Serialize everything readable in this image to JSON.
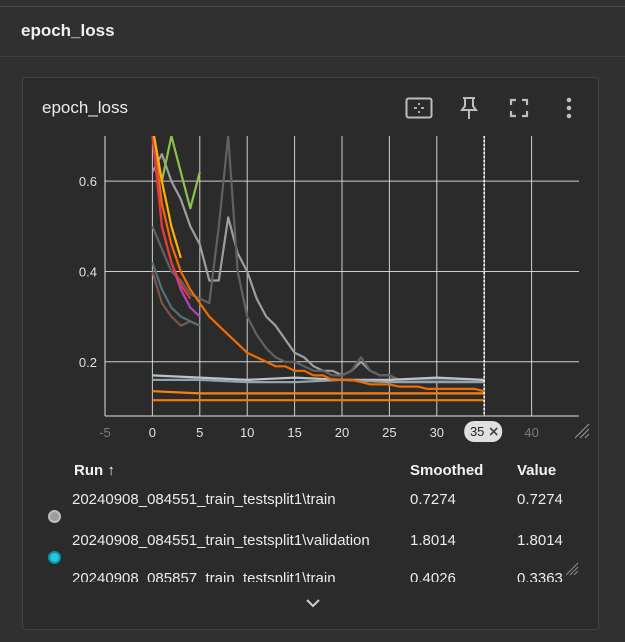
{
  "section": {
    "title": "epoch_loss"
  },
  "card": {
    "title": "epoch_loss",
    "toolbar": [
      {
        "name": "fit-domain-icon",
        "label": "Fit domain to data"
      },
      {
        "name": "pin-icon",
        "label": "Pin card"
      },
      {
        "name": "fullscreen-icon",
        "label": "Toggle fullscreen"
      },
      {
        "name": "more-vert-icon",
        "label": "More options"
      }
    ]
  },
  "chart_data": {
    "type": "line",
    "title": "",
    "xlabel": "",
    "ylabel": "",
    "xlim": [
      -5,
      45
    ],
    "ylim": [
      0.08,
      0.7
    ],
    "xticks": [
      "-5",
      "0",
      "5",
      "10",
      "15",
      "20",
      "25",
      "30",
      "35",
      "40"
    ],
    "yticks": [
      "0.2",
      "0.4",
      "0.6"
    ],
    "grid": true,
    "hover_step": "35",
    "series": [
      {
        "color": "#9e9e9e",
        "x": [
          0,
          1,
          2,
          3,
          4,
          5,
          6,
          7,
          8,
          9,
          10,
          11,
          12,
          13,
          14,
          15,
          16,
          17,
          18,
          19,
          20,
          21,
          22,
          23,
          24,
          25,
          26,
          27,
          28,
          29,
          30,
          31,
          32,
          33,
          34,
          35
        ],
        "y": [
          0.62,
          0.66,
          0.6,
          0.56,
          0.5,
          0.46,
          0.38,
          0.38,
          0.52,
          0.44,
          0.4,
          0.34,
          0.3,
          0.28,
          0.25,
          0.22,
          0.21,
          0.19,
          0.18,
          0.18,
          0.17,
          0.18,
          0.2,
          0.18,
          0.17,
          0.17,
          0.16,
          0.16,
          0.16,
          0.16,
          0.16,
          0.16,
          0.16,
          0.16,
          0.16,
          0.155
        ]
      },
      {
        "color": "#616161",
        "x": [
          0,
          1,
          2,
          3,
          4,
          5,
          6,
          7,
          8,
          9,
          10,
          11,
          12,
          13,
          14,
          15,
          16,
          17,
          18,
          19,
          20,
          21,
          22,
          23,
          24,
          25,
          26,
          27,
          28,
          29,
          30,
          31,
          32,
          33,
          34,
          35
        ],
        "y": [
          0.5,
          0.45,
          0.4,
          0.38,
          0.35,
          0.34,
          0.33,
          0.5,
          0.7,
          0.4,
          0.3,
          0.26,
          0.23,
          0.21,
          0.2,
          0.2,
          0.19,
          0.18,
          0.18,
          0.17,
          0.17,
          0.18,
          0.21,
          0.18,
          0.17,
          0.17,
          0.16,
          0.16,
          0.16,
          0.16,
          0.16,
          0.16,
          0.16,
          0.16,
          0.16,
          0.16
        ]
      },
      {
        "color": "#bdc3c7",
        "x": [
          0,
          5,
          10,
          15,
          20,
          25,
          30,
          35
        ],
        "y": [
          0.17,
          0.165,
          0.16,
          0.165,
          0.16,
          0.16,
          0.165,
          0.16
        ]
      },
      {
        "color": "#90a4ae",
        "x": [
          0,
          5,
          10,
          15,
          20,
          25,
          30,
          35
        ],
        "y": [
          0.16,
          0.16,
          0.155,
          0.155,
          0.16,
          0.155,
          0.155,
          0.155
        ]
      },
      {
        "color": "#ef6c00",
        "x": [
          0,
          1,
          2,
          3,
          4,
          5,
          6,
          7,
          8,
          9,
          10,
          11,
          12,
          13,
          14,
          15,
          16,
          17,
          18,
          19,
          20,
          21,
          22,
          23,
          24,
          25,
          26,
          27,
          28,
          29,
          30,
          31,
          32,
          33,
          34,
          35
        ],
        "y": [
          0.72,
          0.55,
          0.46,
          0.4,
          0.36,
          0.33,
          0.3,
          0.28,
          0.26,
          0.24,
          0.22,
          0.21,
          0.2,
          0.19,
          0.19,
          0.18,
          0.18,
          0.17,
          0.17,
          0.16,
          0.16,
          0.16,
          0.155,
          0.15,
          0.15,
          0.15,
          0.145,
          0.145,
          0.145,
          0.14,
          0.14,
          0.14,
          0.14,
          0.14,
          0.14,
          0.135
        ]
      },
      {
        "color": "#ff7f0e",
        "x": [
          0,
          5,
          10,
          15,
          20,
          25,
          30,
          35
        ],
        "y": [
          0.135,
          0.13,
          0.13,
          0.13,
          0.13,
          0.13,
          0.13,
          0.13
        ]
      },
      {
        "color": "#f57c00",
        "x": [
          0,
          5,
          10,
          15,
          20,
          25,
          30,
          35
        ],
        "y": [
          0.115,
          0.115,
          0.115,
          0.115,
          0.115,
          0.115,
          0.115,
          0.115
        ]
      },
      {
        "color": "#8bc34a",
        "x": [
          0,
          1,
          2,
          3,
          4,
          5
        ],
        "y": [
          0.72,
          0.6,
          0.7,
          0.62,
          0.54,
          0.62
        ]
      },
      {
        "color": "#ab47bc",
        "x": [
          0,
          1,
          2,
          3,
          4,
          5
        ],
        "y": [
          0.72,
          0.5,
          0.42,
          0.36,
          0.32,
          0.3
        ]
      },
      {
        "color": "#e53935",
        "x": [
          0,
          1,
          2,
          3,
          4
        ],
        "y": [
          0.7,
          0.5,
          0.42,
          0.37,
          0.34
        ]
      },
      {
        "color": "#ffb300",
        "x": [
          0,
          1,
          2,
          3
        ],
        "y": [
          0.72,
          0.6,
          0.5,
          0.43
        ]
      },
      {
        "color": "#795548",
        "x": [
          0,
          1,
          2,
          3,
          4,
          5
        ],
        "y": [
          0.4,
          0.33,
          0.3,
          0.28,
          0.29,
          0.28
        ]
      },
      {
        "color": "#546e7a",
        "x": [
          0,
          1,
          2,
          3,
          4,
          5
        ],
        "y": [
          0.42,
          0.36,
          0.32,
          0.3,
          0.29,
          0.28
        ]
      }
    ]
  },
  "table": {
    "headers": {
      "run": "Run ↑",
      "smoothed": "Smoothed",
      "value": "Value"
    },
    "rows": [
      {
        "run": "20240908_084551_train_testsplit1\\train",
        "smoothed": "0.7274",
        "value": "0.7274",
        "color": "#9e9e9e",
        "outline": "#bdbdbd"
      },
      {
        "run": "20240908_084551_train_testsplit1\\validation",
        "smoothed": "1.8014",
        "value": "1.8014",
        "color": "#26c6da",
        "outline": "#0097a7"
      },
      {
        "run": "20240908_085857_train_testsplit1\\train",
        "smoothed": "0.4026",
        "value": "0.3363",
        "color": "#ef6c00",
        "outline": "#ef6c00"
      }
    ]
  }
}
